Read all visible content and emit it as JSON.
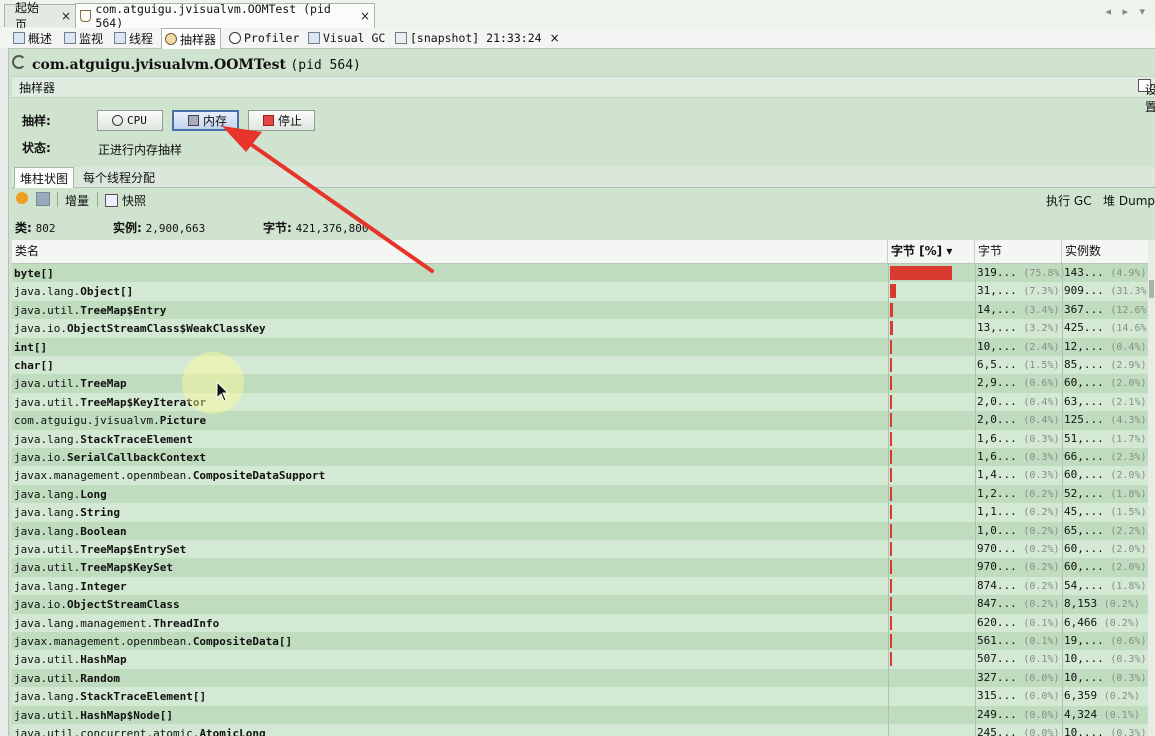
{
  "doc_tabs": [
    {
      "label": "起始页",
      "close": "×"
    },
    {
      "label": "com.atguigu.jvisualvm.OOMTest (pid 564)",
      "close": "×"
    }
  ],
  "view_tabs": [
    {
      "label": "概述",
      "icon": "overview-icon"
    },
    {
      "label": "监视",
      "icon": "monitor-icon"
    },
    {
      "label": "线程",
      "icon": "threads-icon"
    },
    {
      "label": "抽样器",
      "icon": "sampler-icon"
    },
    {
      "label": "Profiler",
      "icon": "profiler-icon"
    },
    {
      "label": "Visual GC",
      "icon": "visual-gc-icon"
    },
    {
      "label": "[snapshot] 21:33:24",
      "icon": "snapshot-icon",
      "close": "×"
    }
  ],
  "title": {
    "main": "com.atguigu.jvisualvm.OOMTest",
    "pid": "(pid 564)"
  },
  "sampler": {
    "header": "抽样器",
    "settings_label": "设置",
    "sample_label": "抽样:",
    "status_label": "状态:",
    "status_value": "正进行内存抽样",
    "buttons": {
      "cpu": "CPU",
      "memory": "内存",
      "stop": "停止"
    }
  },
  "sub_tabs": [
    "堆柱状图",
    "每个线程分配"
  ],
  "toolbar": {
    "delta": "增量",
    "snapshot": "快照",
    "gc": "执行 GC",
    "heap_dump": "堆 Dump"
  },
  "summary": {
    "classes_label": "类:",
    "classes": "802",
    "instances_label": "实例:",
    "instances": "2,900,663",
    "bytes_label": "字节:",
    "bytes": "421,376,800"
  },
  "columns": {
    "name": "类名",
    "bytes_pct": "字节 [%] ▾",
    "bytes": "字节",
    "instances": "实例数"
  },
  "rows": [
    {
      "pfx": "",
      "cls": "byte[]",
      "pct": 75.8,
      "bytes": "319...",
      "bytes_pct": "(75.8%)",
      "inst": "143...",
      "inst_pct": "(4.9%)"
    },
    {
      "pfx": "java.lang.",
      "cls": "Object[]",
      "pct": 7.3,
      "bytes": "31,...",
      "bytes_pct": "(7.3%)",
      "inst": "909...",
      "inst_pct": "(31.3%)"
    },
    {
      "pfx": "java.util.",
      "cls": "TreeMap$Entry",
      "pct": 3.4,
      "bytes": "14,...",
      "bytes_pct": "(3.4%)",
      "inst": "367...",
      "inst_pct": "(12.6%)"
    },
    {
      "pfx": "java.io.",
      "cls": "ObjectStreamClass$WeakClassKey",
      "pct": 3.2,
      "bytes": "13,...",
      "bytes_pct": "(3.2%)",
      "inst": "425...",
      "inst_pct": "(14.6%)"
    },
    {
      "pfx": "",
      "cls": "int[]",
      "pct": 2.4,
      "bytes": "10,...",
      "bytes_pct": "(2.4%)",
      "inst": "12,...",
      "inst_pct": "(0.4%)"
    },
    {
      "pfx": "",
      "cls": "char[]",
      "pct": 1.5,
      "bytes": "6,5...",
      "bytes_pct": "(1.5%)",
      "inst": "85,...",
      "inst_pct": "(2.9%)"
    },
    {
      "pfx": "java.util.",
      "cls": "TreeMap",
      "pct": 0.6,
      "bytes": "2,9...",
      "bytes_pct": "(0.6%)",
      "inst": "60,...",
      "inst_pct": "(2.0%)"
    },
    {
      "pfx": "java.util.",
      "cls": "TreeMap$KeyIterator",
      "pct": 0.4,
      "bytes": "2,0...",
      "bytes_pct": "(0.4%)",
      "inst": "63,...",
      "inst_pct": "(2.1%)"
    },
    {
      "pfx": "com.atguigu.jvisualvm.",
      "cls": "Picture",
      "pct": 0.4,
      "bytes": "2,0...",
      "bytes_pct": "(0.4%)",
      "inst": "125...",
      "inst_pct": "(4.3%)"
    },
    {
      "pfx": "java.lang.",
      "cls": "StackTraceElement",
      "pct": 0.3,
      "bytes": "1,6...",
      "bytes_pct": "(0.3%)",
      "inst": "51,...",
      "inst_pct": "(1.7%)"
    },
    {
      "pfx": "java.io.",
      "cls": "SerialCallbackContext",
      "pct": 0.3,
      "bytes": "1,6...",
      "bytes_pct": "(0.3%)",
      "inst": "66,...",
      "inst_pct": "(2.3%)"
    },
    {
      "pfx": "javax.management.openmbean.",
      "cls": "CompositeDataSupport",
      "pct": 0.3,
      "bytes": "1,4...",
      "bytes_pct": "(0.3%)",
      "inst": "60,...",
      "inst_pct": "(2.0%)"
    },
    {
      "pfx": "java.lang.",
      "cls": "Long",
      "pct": 0.2,
      "bytes": "1,2...",
      "bytes_pct": "(0.2%)",
      "inst": "52,...",
      "inst_pct": "(1.8%)"
    },
    {
      "pfx": "java.lang.",
      "cls": "String",
      "pct": 0.2,
      "bytes": "1,1...",
      "bytes_pct": "(0.2%)",
      "inst": "45,...",
      "inst_pct": "(1.5%)"
    },
    {
      "pfx": "java.lang.",
      "cls": "Boolean",
      "pct": 0.2,
      "bytes": "1,0...",
      "bytes_pct": "(0.2%)",
      "inst": "65,...",
      "inst_pct": "(2.2%)"
    },
    {
      "pfx": "java.util.",
      "cls": "TreeMap$EntrySet",
      "pct": 0.2,
      "bytes": "970...",
      "bytes_pct": "(0.2%)",
      "inst": "60,...",
      "inst_pct": "(2.0%)"
    },
    {
      "pfx": "java.util.",
      "cls": "TreeMap$KeySet",
      "pct": 0.2,
      "bytes": "970...",
      "bytes_pct": "(0.2%)",
      "inst": "60,...",
      "inst_pct": "(2.0%)"
    },
    {
      "pfx": "java.lang.",
      "cls": "Integer",
      "pct": 0.2,
      "bytes": "874...",
      "bytes_pct": "(0.2%)",
      "inst": "54,...",
      "inst_pct": "(1.8%)"
    },
    {
      "pfx": "java.io.",
      "cls": "ObjectStreamClass",
      "pct": 0.2,
      "bytes": "847...",
      "bytes_pct": "(0.2%)",
      "inst": "8,153",
      "inst_pct": "(0.2%)"
    },
    {
      "pfx": "java.lang.management.",
      "cls": "ThreadInfo",
      "pct": 0.1,
      "bytes": "620...",
      "bytes_pct": "(0.1%)",
      "inst": "6,466",
      "inst_pct": "(0.2%)"
    },
    {
      "pfx": "javax.management.openmbean.",
      "cls": "CompositeData[]",
      "pct": 0.1,
      "bytes": "561...",
      "bytes_pct": "(0.1%)",
      "inst": "19,...",
      "inst_pct": "(0.6%)"
    },
    {
      "pfx": "java.util.",
      "cls": "HashMap",
      "pct": 0.1,
      "bytes": "507...",
      "bytes_pct": "(0.1%)",
      "inst": "10,...",
      "inst_pct": "(0.3%)"
    },
    {
      "pfx": "java.util.",
      "cls": "Random",
      "pct": 0.0,
      "bytes": "327...",
      "bytes_pct": "(0.0%)",
      "inst": "10,...",
      "inst_pct": "(0.3%)"
    },
    {
      "pfx": "java.lang.",
      "cls": "StackTraceElement[]",
      "pct": 0.0,
      "bytes": "315...",
      "bytes_pct": "(0.0%)",
      "inst": "6,359",
      "inst_pct": "(0.2%)"
    },
    {
      "pfx": "java.util.",
      "cls": "HashMap$Node[]",
      "pct": 0.0,
      "bytes": "249...",
      "bytes_pct": "(0.0%)",
      "inst": "4,324",
      "inst_pct": "(0.1%)"
    },
    {
      "pfx": "java.util.concurrent.atomic.",
      "cls": "AtomicLong",
      "pct": 0.0,
      "bytes": "245...",
      "bytes_pct": "(0.0%)",
      "inst": "10,...",
      "inst_pct": "(0.3%)"
    }
  ],
  "colors": {
    "bar": "#d83a2f",
    "annotation_arrow": "#e8332a"
  }
}
